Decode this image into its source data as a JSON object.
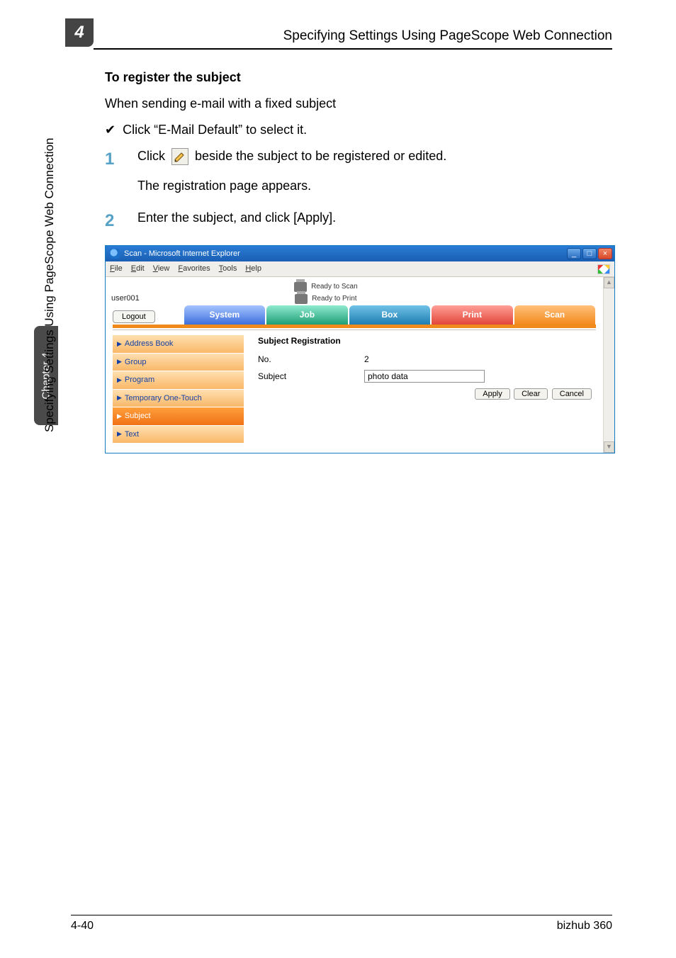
{
  "page_corner": "4",
  "top_title": "Specifying Settings Using PageScope Web Connection",
  "side_tab": "Chapter 4",
  "side_label": "Specifying Settings Using PageScope Web Connection",
  "heading": "To register the subject",
  "intro": "When sending e-mail with a fixed subject",
  "bullet1": "Click “E-Mail Default” to select it.",
  "step1_num": "1",
  "step1_a": "Click",
  "step1_b": "beside the subject to be registered or edited.",
  "step1_sub": "The registration page appears.",
  "step2_num": "2",
  "step2": "Enter the subject, and click [Apply].",
  "browser": {
    "title": "Scan - Microsoft Internet Explorer",
    "menus": [
      "File",
      "Edit",
      "View",
      "Favorites",
      "Tools",
      "Help"
    ],
    "status_scan": "Ready to Scan",
    "status_print": "Ready to Print",
    "username": "user001",
    "logout": "Logout",
    "tabs": {
      "system": "System",
      "job": "Job",
      "box": "Box",
      "print": "Print",
      "scan": "Scan"
    },
    "side": {
      "address": "Address Book",
      "group": "Group",
      "program": "Program",
      "temp": "Temporary One-Touch",
      "subject": "Subject",
      "text": "Text"
    },
    "panel": {
      "title": "Subject Registration",
      "no_label": "No.",
      "no_value": "2",
      "subject_label": "Subject",
      "subject_value": "photo data",
      "apply": "Apply",
      "clear": "Clear",
      "cancel": "Cancel"
    }
  },
  "footer_left": "4-40",
  "footer_right": "bizhub 360"
}
